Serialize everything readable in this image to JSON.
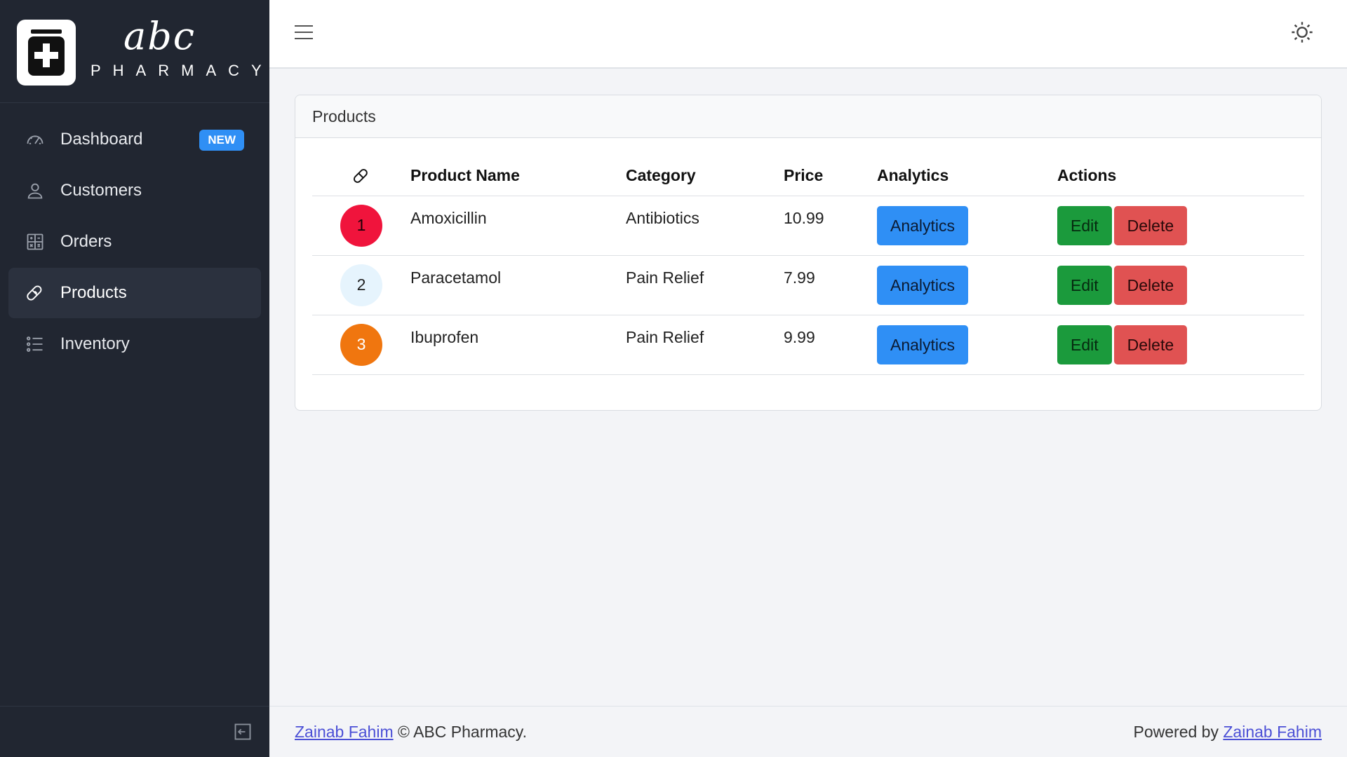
{
  "brand": {
    "script": "abc",
    "name": "PHARMACY"
  },
  "sidebar": {
    "items": [
      {
        "label": "Dashboard",
        "icon": "speedometer-icon",
        "badge": "NEW",
        "active": false
      },
      {
        "label": "Customers",
        "icon": "user-icon",
        "active": false
      },
      {
        "label": "Orders",
        "icon": "calculator-icon",
        "active": false
      },
      {
        "label": "Products",
        "icon": "bandage-icon",
        "active": true
      },
      {
        "label": "Inventory",
        "icon": "list-icon",
        "active": false
      }
    ]
  },
  "header": {
    "menu_icon": "hamburger-icon",
    "theme_icon": "sun-icon"
  },
  "card": {
    "title": "Products",
    "columns": [
      "",
      "Product Name",
      "Category",
      "Price",
      "Analytics",
      "Actions"
    ],
    "rows": [
      {
        "index": "1",
        "badge_color": "#f0143c",
        "badge_text_color": "#1a0006",
        "name": "Amoxicillin",
        "category": "Antibiotics",
        "price": "10.99",
        "analytics": "Analytics",
        "edit": "Edit",
        "delete": "Delete"
      },
      {
        "index": "2",
        "badge_color": "#e6f4fd",
        "badge_text_color": "#222222",
        "name": "Paracetamol",
        "category": "Pain Relief",
        "price": "7.99",
        "analytics": "Analytics",
        "edit": "Edit",
        "delete": "Delete"
      },
      {
        "index": "3",
        "badge_color": "#f0760f",
        "badge_text_color": "#ffffff",
        "name": "Ibuprofen",
        "category": "Pain Relief",
        "price": "9.99",
        "analytics": "Analytics",
        "edit": "Edit",
        "delete": "Delete"
      }
    ]
  },
  "footer": {
    "left_link": "Zainab Fahim",
    "left_text": " © ABC Pharmacy.",
    "right_text": "Powered by ",
    "right_link": "Zainab Fahim"
  },
  "colors": {
    "sidebar_bg": "#212631",
    "accent": "#2f8ff5",
    "edit": "#1b9a3c",
    "delete": "#e05252"
  }
}
